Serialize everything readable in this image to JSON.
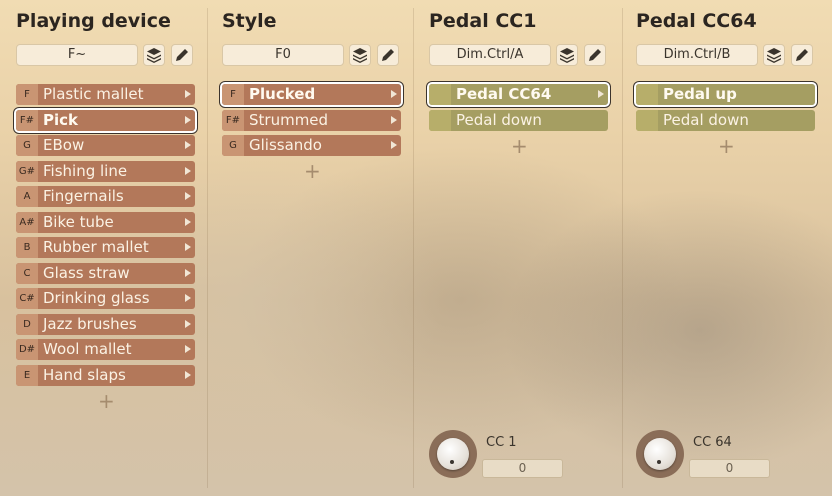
{
  "columns": [
    {
      "title": "Playing device",
      "field": "F~",
      "list_color": "#b3785a",
      "items": [
        {
          "key": "F",
          "label": "Plastic mallet"
        },
        {
          "key": "F#",
          "label": "Pick"
        },
        {
          "key": "G",
          "label": "EBow"
        },
        {
          "key": "G#",
          "label": "Fishing line"
        },
        {
          "key": "A",
          "label": "Fingernails"
        },
        {
          "key": "A#",
          "label": "Bike tube"
        },
        {
          "key": "B",
          "label": "Rubber mallet"
        },
        {
          "key": "C",
          "label": "Glass straw"
        },
        {
          "key": "C#",
          "label": "Drinking glass"
        },
        {
          "key": "D",
          "label": "Jazz brushes"
        },
        {
          "key": "D#",
          "label": "Wool mallet"
        },
        {
          "key": "E",
          "label": "Hand slaps"
        }
      ],
      "selected_index": 1,
      "add_symbol": "+"
    },
    {
      "title": "Style",
      "field": "F0",
      "list_color": "#b3785a",
      "items": [
        {
          "key": "F",
          "label": "Plucked"
        },
        {
          "key": "F#",
          "label": "Strummed"
        },
        {
          "key": "G",
          "label": "Glissando"
        }
      ],
      "selected_index": 0,
      "add_symbol": "+"
    },
    {
      "title": "Pedal CC1",
      "field": "Dim.Ctrl/A",
      "list_color": "#a59e62",
      "items": [
        {
          "key": "",
          "label": "Pedal CC64"
        },
        {
          "key": "",
          "label": "Pedal down"
        }
      ],
      "selected_index": 0,
      "add_symbol": "+",
      "cc": {
        "label": "CC 1",
        "value": "0"
      }
    },
    {
      "title": "Pedal CC64",
      "field": "Dim.Ctrl/B",
      "list_color": "#a59e62",
      "items": [
        {
          "key": "",
          "label": "Pedal up"
        },
        {
          "key": "",
          "label": "Pedal down"
        }
      ],
      "selected_index": 0,
      "add_symbol": "+",
      "cc": {
        "label": "CC 64",
        "value": "0"
      }
    }
  ],
  "icons": {
    "layers": "layers-icon",
    "edit": "pencil-icon"
  }
}
